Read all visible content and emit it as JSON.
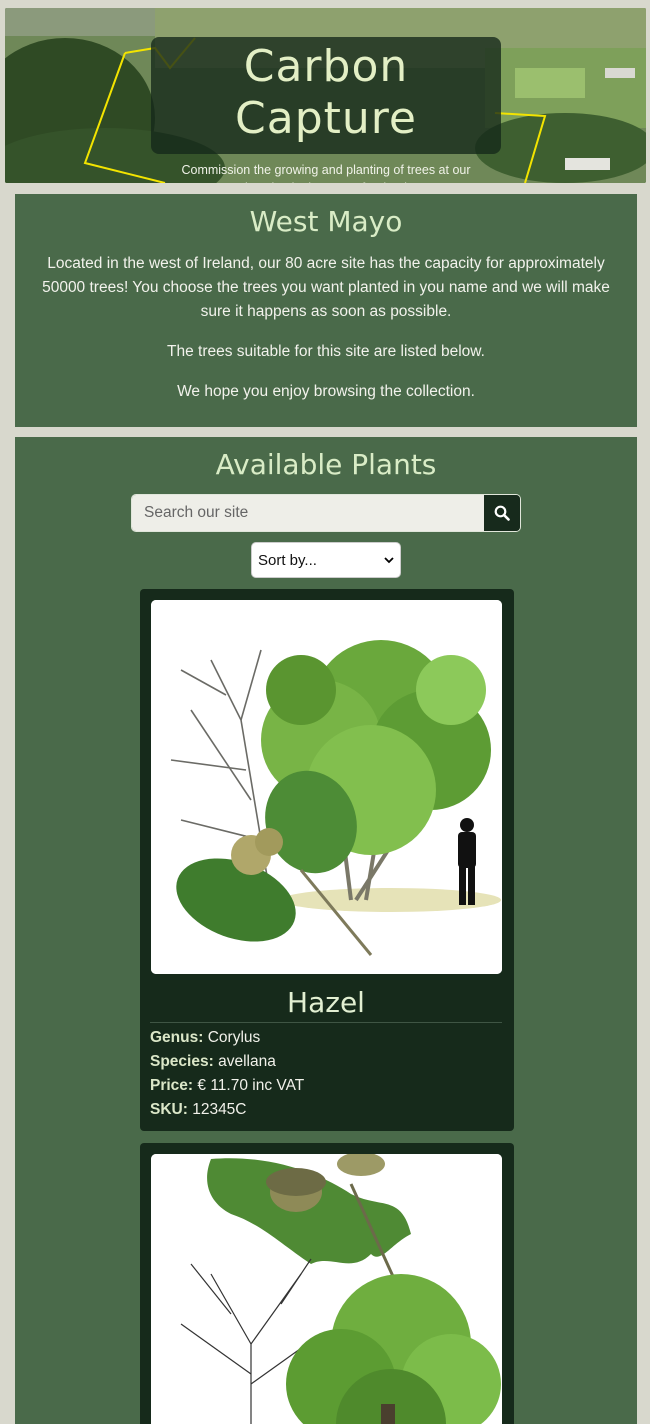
{
  "hero": {
    "title": "Carbon Capture",
    "subtitle": "Commission the growing and planting of trees at our location in the west of Ireland"
  },
  "intro": {
    "heading": "West Mayo",
    "paragraphs": [
      "Located in the west of Ireland, our 80 acre site has the capacity for approximately 50000 trees! You choose the trees you want planted in you name and we will make sure it happens as soon as possible.",
      "The trees suitable for this site are listed below.",
      "We hope you enjoy browsing the collection."
    ]
  },
  "plants": {
    "heading": "Available Plants",
    "search": {
      "placeholder": "Search our site"
    },
    "sort": {
      "selected": "Sort by..."
    },
    "items": [
      {
        "name": "Hazel",
        "genus_label": "Genus:",
        "genus": "Corylus",
        "species_label": "Species:",
        "species": "avellana",
        "price_label": "Price:",
        "price": "€ 11.70 inc VAT",
        "sku_label": "SKU:",
        "sku": "12345C"
      }
    ]
  },
  "colors": {
    "panel": "#4a6a4a",
    "card": "#162a1b",
    "accent": "#d9ecc6"
  }
}
